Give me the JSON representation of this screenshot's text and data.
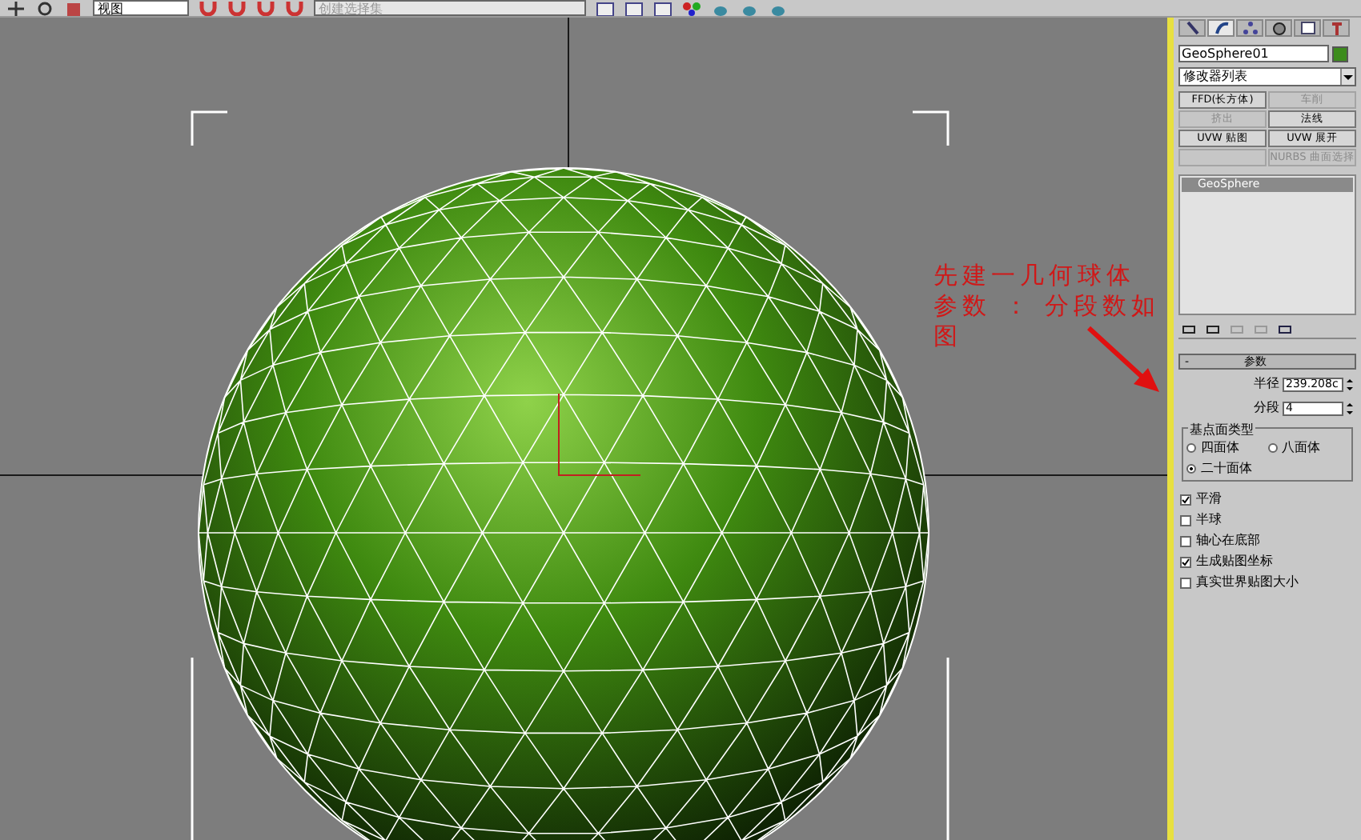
{
  "toolbar": {
    "view_dropdown": "视图",
    "selection_set_dropdown": "创建选择集"
  },
  "viewport": {
    "annotation": [
      "先建一几何球体",
      "参数 ： 分段数如图"
    ]
  },
  "command_panel": {
    "tabs": [
      {
        "kind": "create",
        "selected": false
      },
      {
        "kind": "modify",
        "selected": true
      },
      {
        "kind": "hierarchy",
        "selected": false
      },
      {
        "kind": "motion",
        "selected": false
      },
      {
        "kind": "display",
        "selected": false
      },
      {
        "kind": "utilities",
        "selected": false
      }
    ],
    "object_name": "GeoSphere01",
    "modifier_list": "修改器列表",
    "modifier_buttons": [
      {
        "label": "FFD(长方体)",
        "disabled": false
      },
      {
        "label": "车削",
        "disabled": true
      },
      {
        "label": "挤出",
        "disabled": true
      },
      {
        "label": "法线",
        "disabled": false
      },
      {
        "label": "UVW 贴图",
        "disabled": false
      },
      {
        "label": "UVW 展开",
        "disabled": false
      },
      {
        "disabled": true
      },
      {
        "label": "NURBS 曲面选择",
        "disabled": true
      }
    ],
    "stack": [
      {
        "label": "GeoSphere",
        "selected": true
      }
    ],
    "rollout": {
      "title": "参数",
      "collapse": "-",
      "fields": [
        {
          "label": "半径",
          "value": "239.208c"
        },
        {
          "label": "分段",
          "value": "4"
        }
      ],
      "group": {
        "title": "基点面类型",
        "options": [
          {
            "label": "四面体",
            "selected": false
          },
          {
            "label": "八面体",
            "selected": false
          },
          {
            "label": "二十面体",
            "selected": true
          }
        ]
      },
      "checkboxes": [
        {
          "label": "平滑",
          "checked": true
        },
        {
          "label": "半球",
          "checked": false
        },
        {
          "label": "轴心在底部",
          "checked": false
        },
        {
          "label": "生成贴图坐标",
          "checked": true
        },
        {
          "label": "真实世界贴图大小",
          "checked": false
        }
      ]
    }
  }
}
